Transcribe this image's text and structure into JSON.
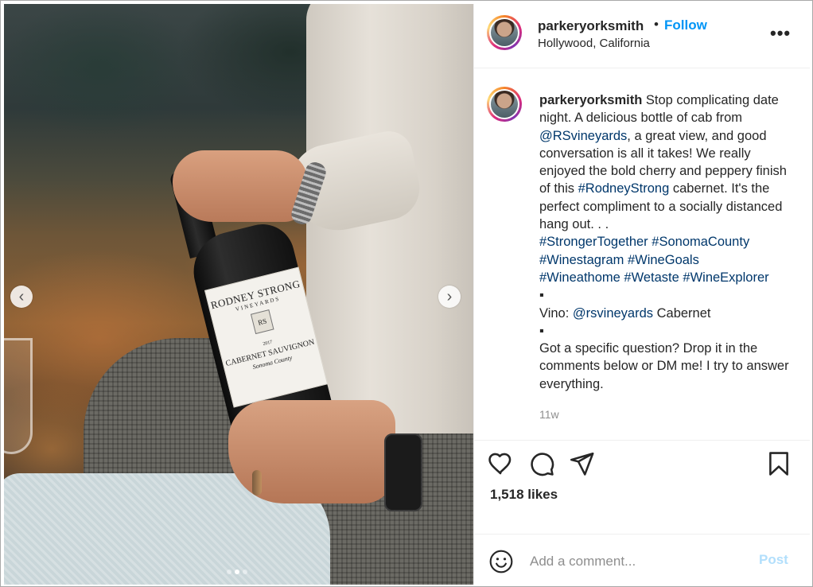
{
  "post": {
    "username": "parkeryorksmith",
    "separator": "•",
    "follow_label": "Follow",
    "location": "Hollywood, California",
    "more_label": "•••"
  },
  "photo": {
    "label_brand": "RODNEY STRONG",
    "label_sub": "VINEYARDS",
    "label_crest": "RS",
    "label_year": "2017",
    "label_varietal": "CABERNET SAUVIGNON",
    "label_region": "Sonoma County",
    "prev_label": "‹",
    "next_label": "›",
    "slide_count": 3,
    "active_slide": 2
  },
  "caption": {
    "username": "parkeryorksmith",
    "p1": " Stop complicating date night. A delicious bottle of cab from ",
    "mention1": "@RSvineyards",
    "p2": ", a great view, and good conversation is all it takes! We really enjoyed the bold cherry and peppery finish of this ",
    "tag_rodney": "#RodneyStrong",
    "p3": " cabernet. It's the perfect compliment to a socially distanced hang out. . .\n",
    "tag1": "#StrongerTogether",
    "tag2": "#SonomaCounty",
    "tag3": "#Winestagram",
    "tag4": "#WineGoals",
    "tag5": "#Wineathome",
    "tag6": "#Wetaste",
    "tag7": "#WineExplorer",
    "bullet": "▪",
    "vino_label": "Vino: ",
    "mention2": "@rsvineyards",
    "vino_after": " Cabernet",
    "p4": "Got a specific question? Drop it in the comments below or DM me! I try to answer everything."
  },
  "time_ago": "11w",
  "likes_text": "1,518 likes",
  "icons": {
    "like": "heart-icon",
    "comment": "comment-icon",
    "share": "share-icon",
    "save": "bookmark-icon",
    "emoji": "emoji-icon"
  },
  "comment": {
    "placeholder": "Add a comment...",
    "post_label": "Post",
    "post_color": "#b2dffc"
  },
  "colors": {
    "accent": "#0095f6",
    "link": "#00376b",
    "muted": "#8e8e8e"
  }
}
